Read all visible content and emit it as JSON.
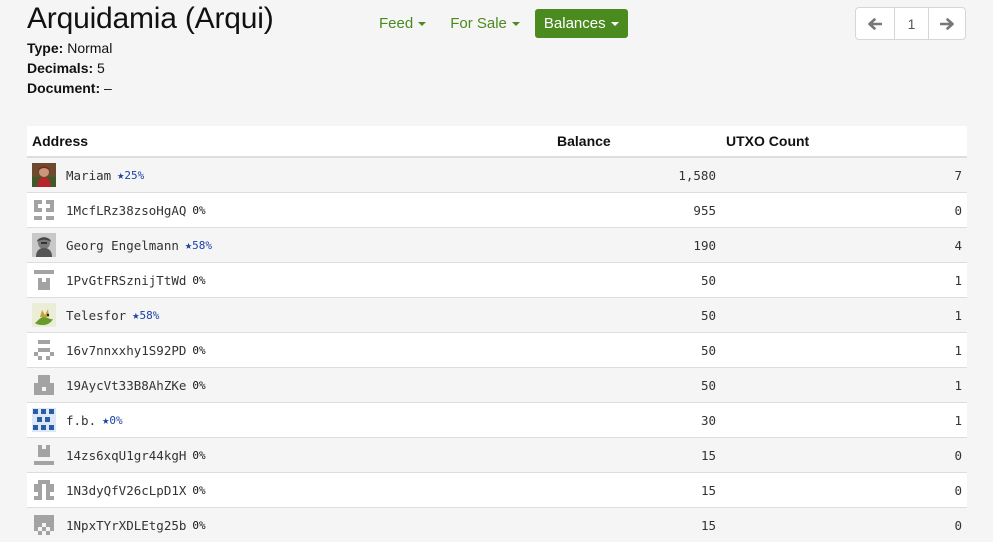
{
  "header": {
    "title": "Arquidamia (Arqui)",
    "type_label": "Type:",
    "type_value": "Normal",
    "decimals_label": "Decimals:",
    "decimals_value": "5",
    "document_label": "Document:",
    "document_value": "–"
  },
  "nav": {
    "feed": "Feed",
    "for_sale": "For Sale",
    "balances": "Balances",
    "active": "balances",
    "accent_color": "#4b8a1f"
  },
  "pager": {
    "prev_icon": "arrow-left-icon",
    "page": "1",
    "next_icon": "arrow-right-icon"
  },
  "table": {
    "columns": [
      "Address",
      "Balance",
      "UTXO Count"
    ],
    "rows": [
      {
        "name": "Mariam",
        "trust": "25%",
        "starred": true,
        "balance": "1,580",
        "utxo": "7",
        "avatar": "photo-portrait-red"
      },
      {
        "name": "1McfLRz38zsoHgAQ",
        "trust": "0%",
        "starred": false,
        "balance": "955",
        "utxo": "0",
        "avatar": "identicon"
      },
      {
        "name": "Georg Engelmann",
        "trust": "58%",
        "starred": true,
        "balance": "190",
        "utxo": "4",
        "avatar": "photo-portrait-gray"
      },
      {
        "name": "1PvGtFRSznijTtWd",
        "trust": "0%",
        "starred": false,
        "balance": "50",
        "utxo": "1",
        "avatar": "identicon"
      },
      {
        "name": "Telesfor",
        "trust": "58%",
        "starred": true,
        "balance": "50",
        "utxo": "1",
        "avatar": "photo-dragon"
      },
      {
        "name": "16v7nnxxhy1S92PD",
        "trust": "0%",
        "starred": false,
        "balance": "50",
        "utxo": "1",
        "avatar": "identicon"
      },
      {
        "name": "19AycVt33B8AhZKe",
        "trust": "0%",
        "starred": false,
        "balance": "50",
        "utxo": "1",
        "avatar": "identicon"
      },
      {
        "name": "f.b.",
        "trust": "0%",
        "starred": true,
        "balance": "30",
        "utxo": "1",
        "avatar": "photo-pattern-blue"
      },
      {
        "name": "14zs6xqU1gr44kgH",
        "trust": "0%",
        "starred": false,
        "balance": "15",
        "utxo": "0",
        "avatar": "identicon"
      },
      {
        "name": "1N3dyQfV26cLpD1X",
        "trust": "0%",
        "starred": false,
        "balance": "15",
        "utxo": "0",
        "avatar": "identicon"
      },
      {
        "name": "1NpxTYrXDLEtg25b",
        "trust": "0%",
        "starred": false,
        "balance": "15",
        "utxo": "0",
        "avatar": "identicon"
      }
    ]
  }
}
